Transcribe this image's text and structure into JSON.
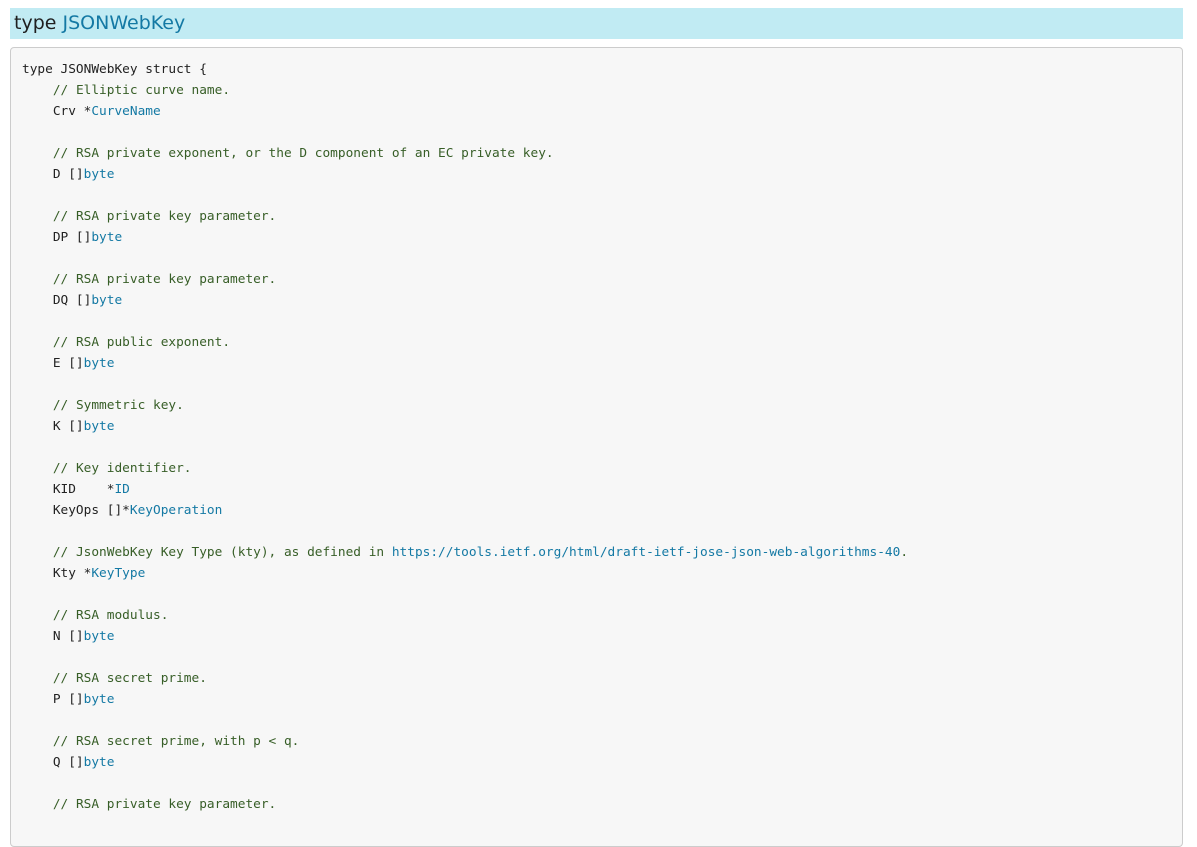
{
  "header": {
    "keyword": "type",
    "type_name": "JSONWebKey"
  },
  "code": {
    "lines": [
      [
        {
          "t": "type JSONWebKey struct {"
        }
      ],
      [
        {
          "t": "    "
        },
        {
          "t": "// Elliptic curve name.",
          "c": "cmt"
        }
      ],
      [
        {
          "t": "    Crv *"
        },
        {
          "t": "CurveName",
          "c": "lnk"
        }
      ],
      [],
      [
        {
          "t": "    "
        },
        {
          "t": "// RSA private exponent, or the D component of an EC private key.",
          "c": "cmt"
        }
      ],
      [
        {
          "t": "    D []"
        },
        {
          "t": "byte",
          "c": "lnk"
        }
      ],
      [],
      [
        {
          "t": "    "
        },
        {
          "t": "// RSA private key parameter.",
          "c": "cmt"
        }
      ],
      [
        {
          "t": "    DP []"
        },
        {
          "t": "byte",
          "c": "lnk"
        }
      ],
      [],
      [
        {
          "t": "    "
        },
        {
          "t": "// RSA private key parameter.",
          "c": "cmt"
        }
      ],
      [
        {
          "t": "    DQ []"
        },
        {
          "t": "byte",
          "c": "lnk"
        }
      ],
      [],
      [
        {
          "t": "    "
        },
        {
          "t": "// RSA public exponent.",
          "c": "cmt"
        }
      ],
      [
        {
          "t": "    E []"
        },
        {
          "t": "byte",
          "c": "lnk"
        }
      ],
      [],
      [
        {
          "t": "    "
        },
        {
          "t": "// Symmetric key.",
          "c": "cmt"
        }
      ],
      [
        {
          "t": "    K []"
        },
        {
          "t": "byte",
          "c": "lnk"
        }
      ],
      [],
      [
        {
          "t": "    "
        },
        {
          "t": "// Key identifier.",
          "c": "cmt"
        }
      ],
      [
        {
          "t": "    KID    *"
        },
        {
          "t": "ID",
          "c": "lnk"
        }
      ],
      [
        {
          "t": "    KeyOps []*"
        },
        {
          "t": "KeyOperation",
          "c": "lnk"
        }
      ],
      [],
      [
        {
          "t": "    "
        },
        {
          "t": "// JsonWebKey Key Type (kty), as defined in ",
          "c": "cmt"
        },
        {
          "t": "https://tools.ietf.org/html/draft-ietf-jose-json-web-algorithms-40",
          "c": "lnk"
        },
        {
          "t": ".",
          "c": "cmt"
        }
      ],
      [
        {
          "t": "    Kty *"
        },
        {
          "t": "KeyType",
          "c": "lnk"
        }
      ],
      [],
      [
        {
          "t": "    "
        },
        {
          "t": "// RSA modulus.",
          "c": "cmt"
        }
      ],
      [
        {
          "t": "    N []"
        },
        {
          "t": "byte",
          "c": "lnk"
        }
      ],
      [],
      [
        {
          "t": "    "
        },
        {
          "t": "// RSA secret prime.",
          "c": "cmt"
        }
      ],
      [
        {
          "t": "    P []"
        },
        {
          "t": "byte",
          "c": "lnk"
        }
      ],
      [],
      [
        {
          "t": "    "
        },
        {
          "t": "// RSA secret prime, with p < q.",
          "c": "cmt"
        }
      ],
      [
        {
          "t": "    Q []"
        },
        {
          "t": "byte",
          "c": "lnk"
        }
      ],
      [],
      [
        {
          "t": "    "
        },
        {
          "t": "// RSA private key parameter.",
          "c": "cmt"
        }
      ]
    ]
  },
  "colors": {
    "header_bg": "#c1ebf3",
    "link": "#1479a4",
    "comment": "#375e27",
    "code_bg": "#f7f7f7"
  }
}
